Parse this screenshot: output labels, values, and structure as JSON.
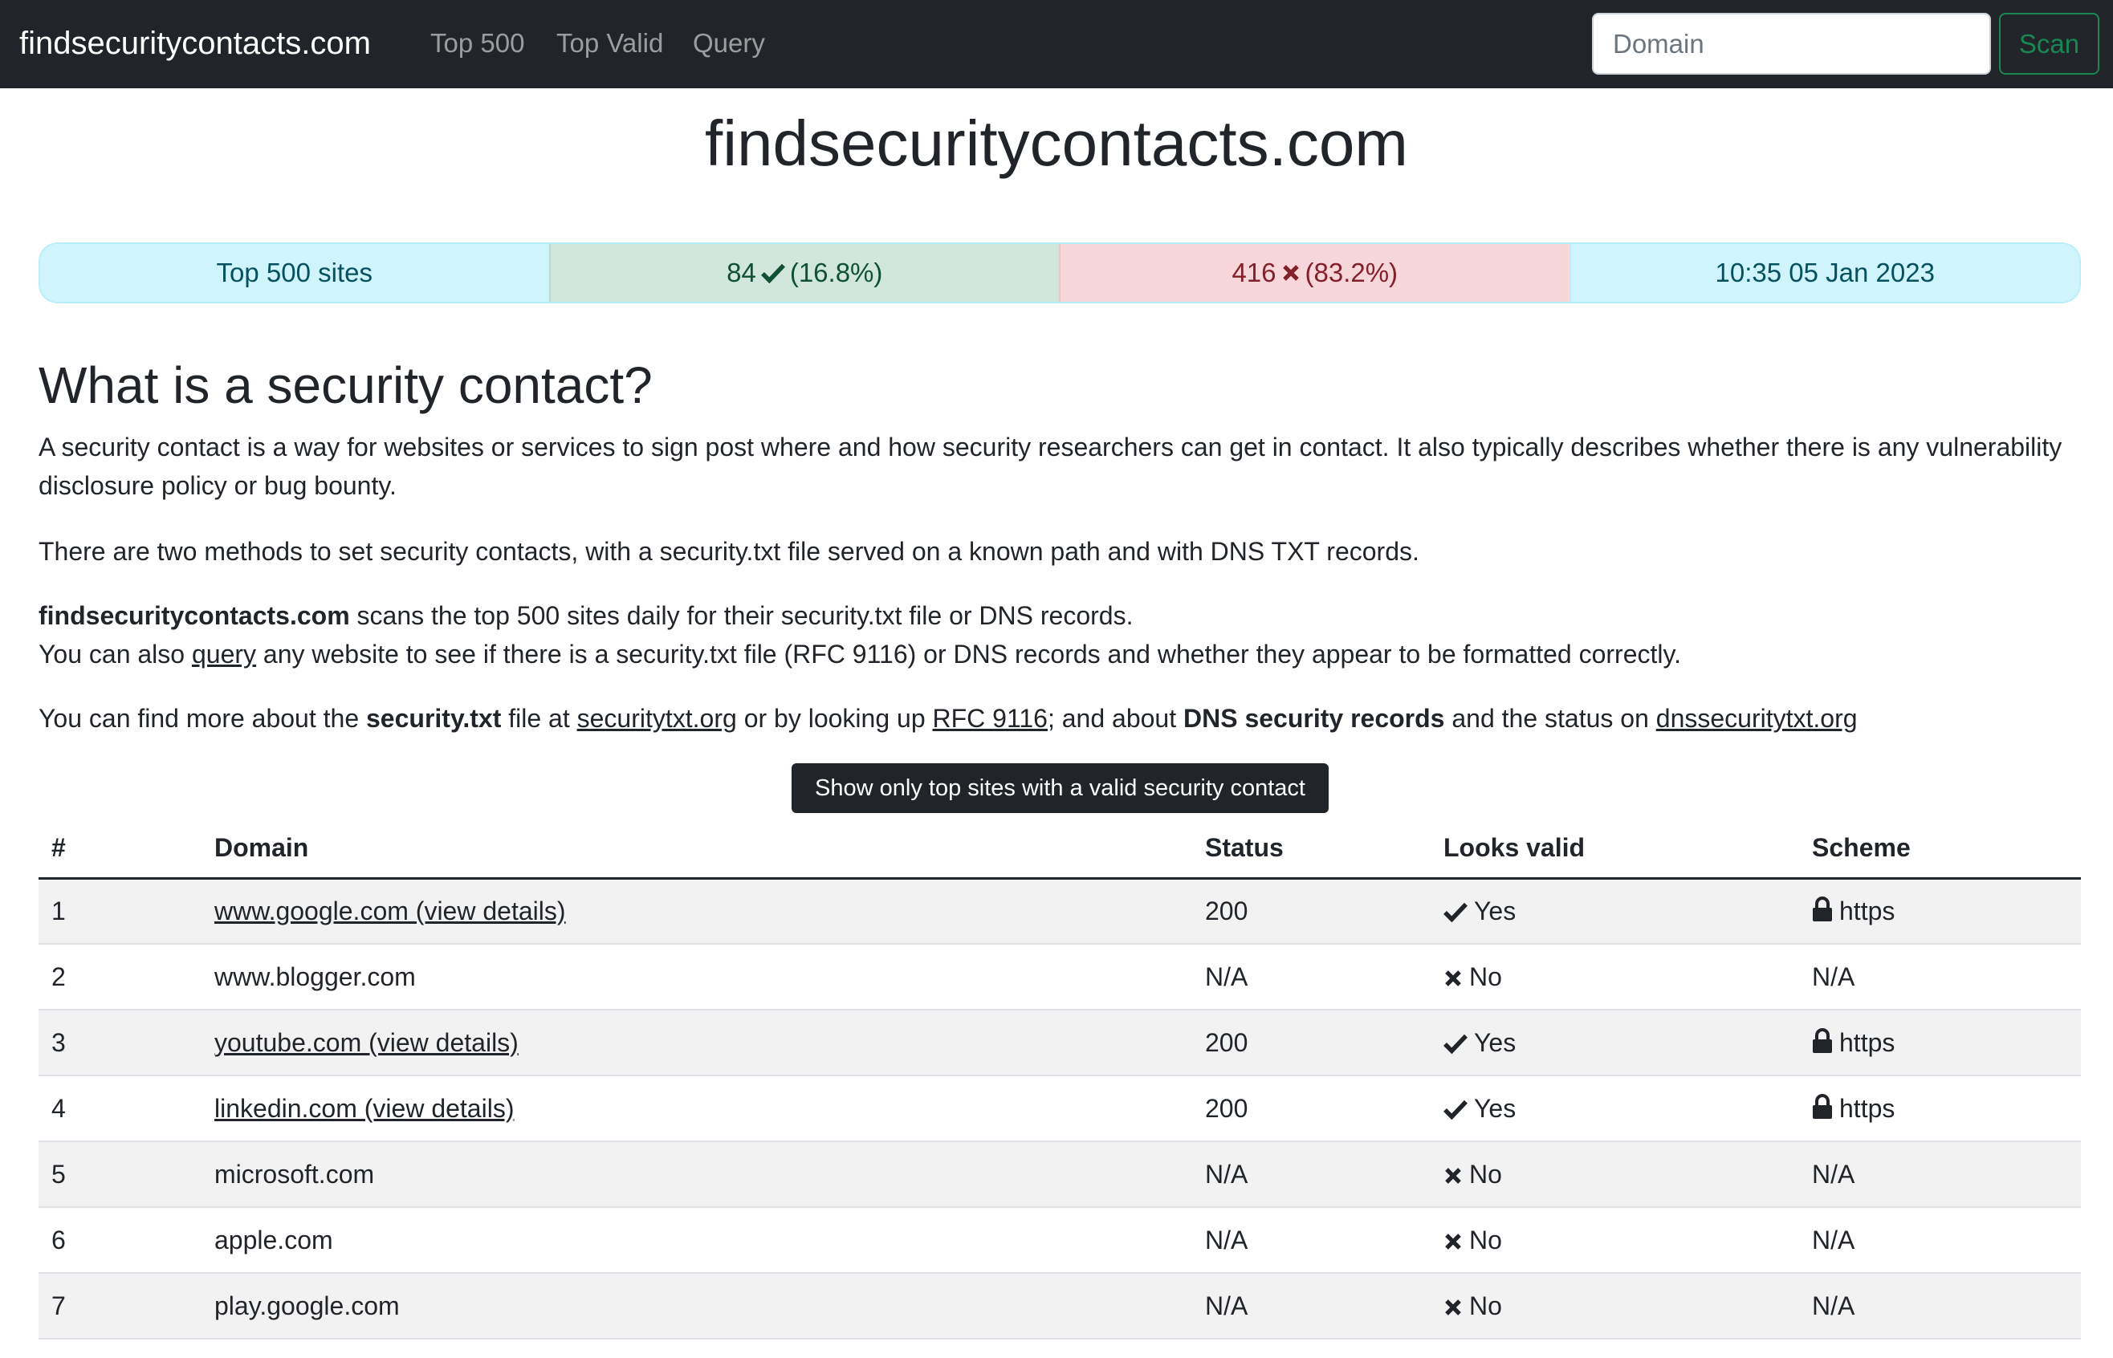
{
  "nav": {
    "brand": "findsecuritycontacts.com",
    "links": [
      "Top 500",
      "Top Valid",
      "Query"
    ],
    "search_placeholder": "Domain",
    "scan_label": "Scan"
  },
  "page_title": "findsecuritycontacts.com",
  "stats": {
    "label": "Top 500 sites",
    "valid_count": "84",
    "valid_pct": "(16.8%)",
    "invalid_count": "416",
    "invalid_pct": "(83.2%)",
    "timestamp": "10:35 05 Jan 2023"
  },
  "intro": {
    "heading": "What is a security contact?",
    "p1": "A security contact is a way for websites or services to sign post where and how security researchers can get in contact. It also typically describes whether there is any vulnerability disclosure policy or bug bounty.",
    "p2": "There are two methods to set security contacts, with a security.txt file served on a known path and with DNS TXT records.",
    "p3_bold": "findsecuritycontacts.com",
    "p3_rest": " scans the top 500 sites daily for their security.txt file or DNS records.",
    "p3_line2_a": "You can also ",
    "p3_link": "query",
    "p3_line2_b": " any website to see if there is a security.txt file (RFC 9116) or DNS records and whether they appear to be formatted correctly.",
    "p4_a": "You can find more about the ",
    "p4_bold1": "security.txt",
    "p4_b": " file at ",
    "p4_link1": "securitytxt.org",
    "p4_c": " or by looking up ",
    "p4_link2": "RFC 9116",
    "p4_d": "; and about ",
    "p4_bold2": "DNS security records",
    "p4_e": " and the status on ",
    "p4_link3": "dnssecuritytxt.org"
  },
  "filter_button": "Show only top sites with a valid security contact",
  "table": {
    "headers": [
      "#",
      "Domain",
      "Status",
      "Looks valid",
      "Scheme"
    ],
    "rows": [
      {
        "num": "1",
        "domain": "www.google.com (view details)",
        "link": true,
        "status": "200",
        "valid": "Yes",
        "ok": true,
        "scheme": "https"
      },
      {
        "num": "2",
        "domain": "www.blogger.com",
        "link": false,
        "status": "N/A",
        "valid": "No",
        "ok": false,
        "scheme": "N/A"
      },
      {
        "num": "3",
        "domain": "youtube.com (view details)",
        "link": true,
        "status": "200",
        "valid": "Yes",
        "ok": true,
        "scheme": "https"
      },
      {
        "num": "4",
        "domain": "linkedin.com (view details)",
        "link": true,
        "status": "200",
        "valid": "Yes",
        "ok": true,
        "scheme": "https"
      },
      {
        "num": "5",
        "domain": "microsoft.com",
        "link": false,
        "status": "N/A",
        "valid": "No",
        "ok": false,
        "scheme": "N/A"
      },
      {
        "num": "6",
        "domain": "apple.com",
        "link": false,
        "status": "N/A",
        "valid": "No",
        "ok": false,
        "scheme": "N/A"
      },
      {
        "num": "7",
        "domain": "play.google.com",
        "link": false,
        "status": "N/A",
        "valid": "No",
        "ok": false,
        "scheme": "N/A"
      }
    ]
  }
}
